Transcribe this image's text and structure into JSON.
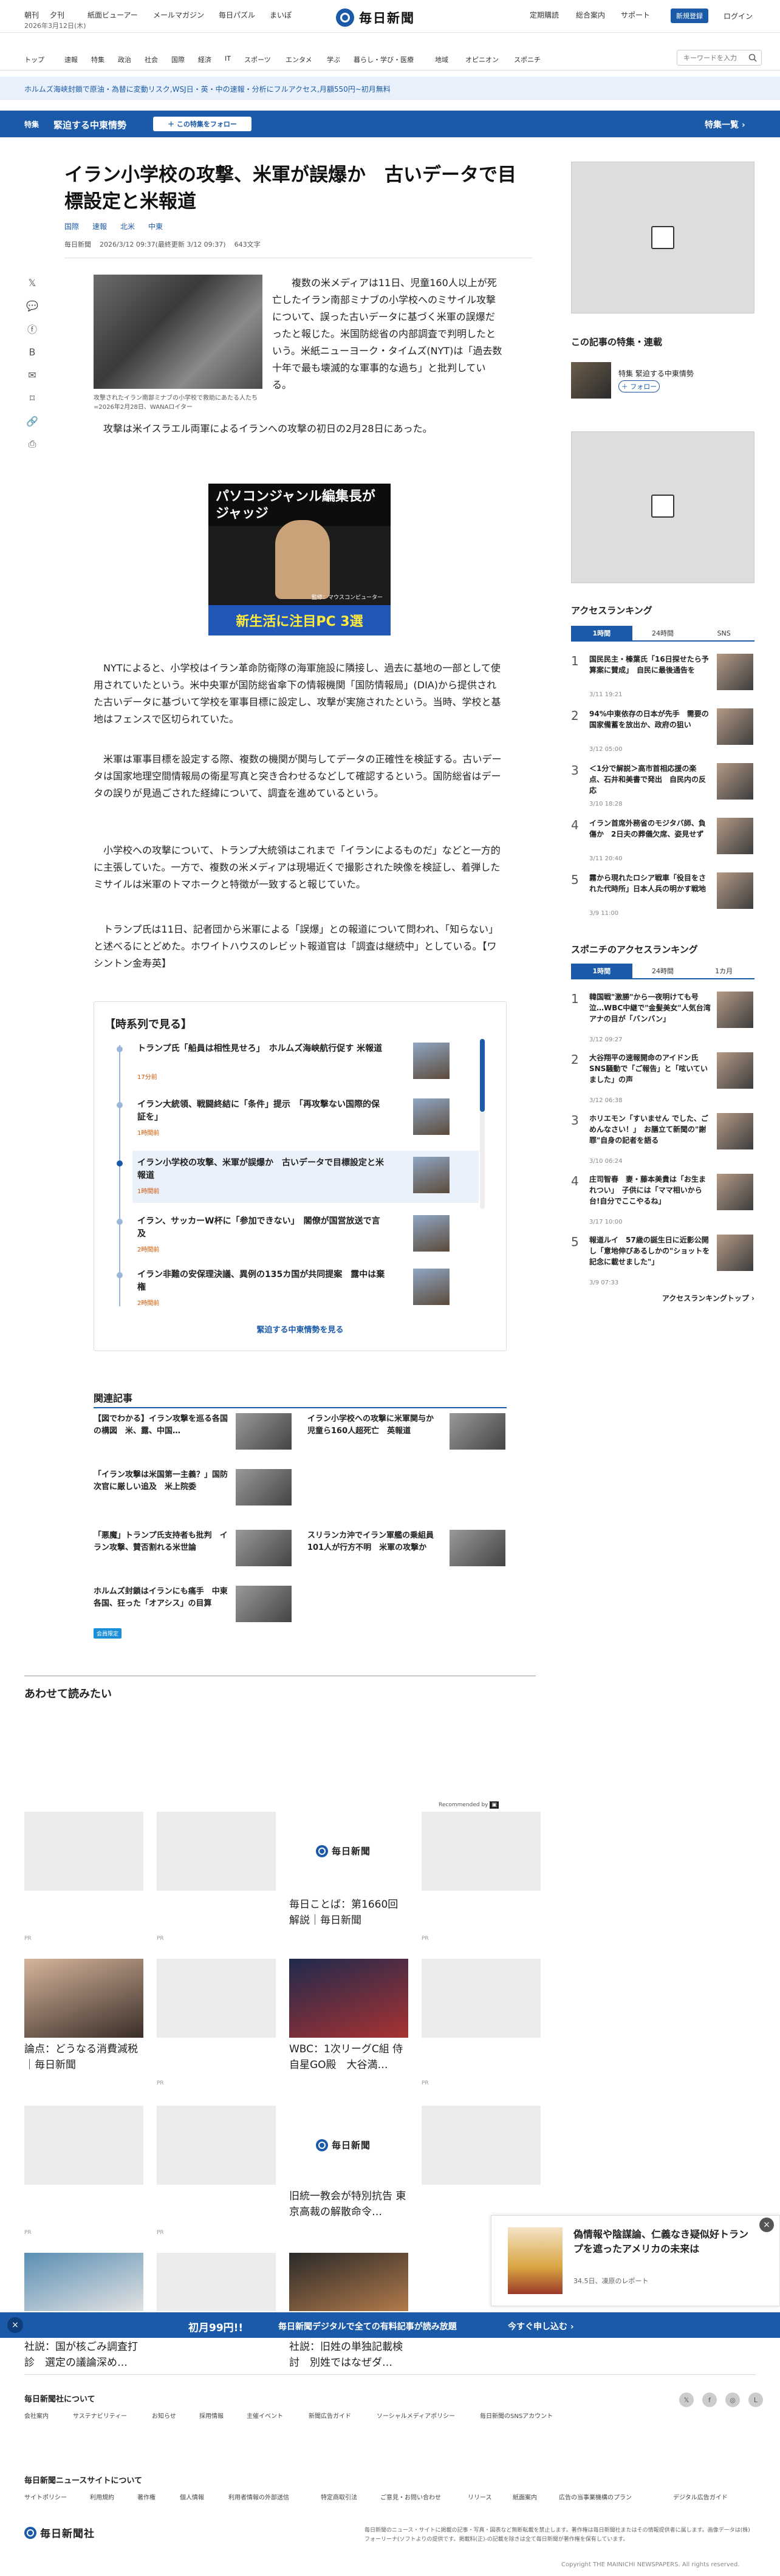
{
  "header": {
    "top_links": [
      "朝刊",
      "夕刊",
      "紙面ビューアー",
      "メールマガジン",
      "毎日パズル",
      "まいぽ"
    ],
    "date": "2026年3月12日(木)",
    "logo": "毎日新聞",
    "right_links": [
      "定期購読",
      "総合案内",
      "サポート"
    ],
    "register": "新規登録",
    "login": "ログイン"
  },
  "nav": {
    "items": [
      "トップ",
      "速報",
      "特集",
      "政治",
      "社会",
      "国際",
      "経済",
      "IT",
      "スポーツ",
      "エンタメ",
      "学ぶ",
      "暮らし・学び・医療",
      "地域",
      "オピニオン",
      "スポニチ"
    ],
    "search_placeholder": "キーワードを入力"
  },
  "promo": "ホルムズ海峡封鎖で原油・為替に変動リスク,WSJ日・英・中の速報・分析にフルアクセス,月額550円~初月無料",
  "feature": {
    "tag": "特集",
    "title": "緊迫する中東情勢",
    "follow": "＋ この特集をフォロー",
    "list": "特集一覧 ›"
  },
  "article": {
    "headline": "イラン小学校の攻撃、米軍が誤爆か　古いデータで目標設定と米報道",
    "tags": [
      "国際",
      "速報",
      "北米",
      "中東"
    ],
    "meta": [
      "毎日新聞",
      "2026/3/12 09:37(最終更新 3/12 09:37)",
      "643文字"
    ],
    "photo_caption": "攻撃されたイラン南部ミナブの小学校で救助にあたる人たち=2026年2月28日、WANAロイター",
    "p1": "複数の米メディアは11日、児童160人以上が死亡したイラン南部ミナブの小学校へのミサイル攻撃について、誤った古いデータに基づく米軍の誤爆だったと報じた。米国防総省の内部調査で判明したという。米紙ニューヨーク・タイムズ(NYT)は「過去数十年で最も壊滅的な軍事的な過ち」と批判している。",
    "p2": "攻撃は米イスラエル両軍によるイランへの攻撃の初日の2月28日にあった。",
    "p3": "NYTによると、小学校はイラン革命防衛隊の海軍施設に隣接し、過去に基地の一部として使用されていたという。米中央軍が国防総省傘下の情報機関「国防情報局」(DIA)から提供された古いデータに基づいて学校を軍事目標に設定し、攻撃が実施されたという。当時、学校と基地はフェンスで区切られていた。",
    "p4": "米軍は軍事目標を設定する際、複数の機関が関与してデータの正確性を検証する。古いデータは国家地理空間情報局の衛星写真と突き合わせるなどして確認するという。国防総省はデータの誤りが見過ごされた経緯について、調査を進めているという。",
    "p5": "小学校への攻撃について、トランプ大統領はこれまで「イランによるものだ」などと一方的に主張していた。一方で、複数の米メディアは現場近くで撮影された映像を検証し、着弾したミサイルは米軍のトマホークと特徴が一致すると報じていた。",
    "p6": "トランプ氏は11日、記者団から米軍による「誤爆」との報道について問われ、「知らない」と述べるにとどめた。ホワイトハウスのレビット報道官は「調査は継続中」としている。【ワシントン金寿英】"
  },
  "ad": {
    "top": "パソコンジャンル編集長が ジャッジ",
    "bottom": "新生活に注目PC 3選",
    "credit": "監修：マウスコンピューター"
  },
  "timeline": {
    "heading": "【時系列で見る】",
    "items": [
      {
        "title": "トランプ氏「船員は相性見せろ」　ホルムズ海峡航行促す 米報道",
        "time": "17分前"
      },
      {
        "title": "イラン大統領、戦闘終結に「条件」提示　「再攻撃ない国際的保証を」",
        "time": "1時間前"
      },
      {
        "title": "イラン小学校の攻撃、米軍が誤爆か　古いデータで目標設定と米報道",
        "time": "1時間前"
      },
      {
        "title": "イラン、サッカーW杯に「参加できない」　閣僚が国営放送で言及",
        "time": "2時間前"
      },
      {
        "title": "イラン非難の安保理決議、異例の135カ国が共同提案　露中は棄権",
        "time": "2時間前"
      }
    ],
    "more": "緊迫する中東情勢を見る"
  },
  "related": {
    "heading": "関連記事",
    "items": [
      {
        "title": "【図でわかる】イラン攻撃を巡る各国の構図　米、露、中国…"
      },
      {
        "title": "イラン小学校への攻撃に米軍関与か　児童ら160人超死亡　英報道"
      },
      {
        "title": "「イラン攻撃は米国第一主義？」国防次官に厳しい追及　米上院委"
      },
      {
        "title": "「悪魔」トランプ氏支持者も批判　イラン攻撃、賛否割れる米世論"
      },
      {
        "title": "スリランカ沖でイラン軍艦の乗組員101人が行方不明　米軍の攻撃か"
      },
      {
        "title": "ホルムズ封鎖はイランにも痛手　中東各国、狂った「オアシス」の目算"
      }
    ],
    "gift": "会員限定"
  },
  "read_together": {
    "heading": "あわせて読みたい",
    "recommended": "Recommended by",
    "pr": "PR",
    "captions": [
      "毎日ことば：第1660回 解説｜毎日新聞",
      "論点：どうなる消費減税｜毎日新聞",
      "WBC：1次リーグC組 侍自星GO殿　大谷満…",
      "旧統一教会が特別抗告 東京高裁の解散命令…",
      "社説：国が核ごみ調査打診　選定の議論深め…",
      "社説：旧姓の単独記載検討　別姓ではなぜダ…"
    ]
  },
  "sidebar": {
    "follow_heading": "この記事の特集・連載",
    "follow_tag": "特集 緊迫する中東情勢",
    "follow_btn": "＋ フォロー",
    "ranking_heading": "アクセスランキング",
    "ranking_tabs": [
      "1時間",
      "24時間",
      "SNS"
    ],
    "ranking": [
      {
        "n": "1",
        "title": "国民民主・榛葉氏「16日探せたら予算案に賛成」　自民に最後通告を"
      },
      {
        "n": "2",
        "title": "94%中東依存の日本が先手　需要の国家備蓄を放出か、政府の狙い"
      },
      {
        "n": "3",
        "title": "＜1分で解説＞高市首相応援の楽点、石井和美書で発出　自民内の反応"
      },
      {
        "n": "4",
        "title": "イラン首席外務省のモジタバ師、負傷か　2日夫の葬儀欠席、姿見せず"
      },
      {
        "n": "5",
        "title": "霧から現れたロシア戦車「役目をされた代時所」日本人兵の明かす戦地"
      }
    ],
    "ranking_dates": [
      "3/11 19:21",
      "3/12 05:00",
      "3/10 18:28",
      "3/11 20:40",
      "3/9 11:00"
    ],
    "sponichi_heading": "スポニチのアクセスランキング",
    "sponichi_tabs": [
      "1時間",
      "24時間",
      "1カ月"
    ],
    "sponichi": [
      {
        "n": "1",
        "title": "韓国戦\"激勝\"から一夜明けても号泣…WBC中継で\"金髪美女\"人気台湾アナの目が「バンバン」"
      },
      {
        "n": "2",
        "title": "大谷翔平の速報開命のアイドン氏　SNS騒動で「ご報告」と「呟いていました」の声"
      },
      {
        "n": "3",
        "title": "ホリエモン「すいません でした、ごめんなさい！」　お膳立て新聞の\"謝罪\"自身の記者を語る"
      },
      {
        "n": "4",
        "title": "庄司智春　妻・藤本美貴は「お生まれつい」　子供には「ママ相いから台!自分でここやるね」"
      },
      {
        "n": "5",
        "title": "報道ルイ　57歳の誕生日に近影公開し「意地伸びあるしかの\"ショットを記念に載せました\"」"
      }
    ],
    "sponichi_dates": [
      "3/12 09:27",
      "3/12 06:38",
      "3/10 06:24",
      "3/17 10:00",
      "3/9 07:33"
    ],
    "ranking_more": "アクセスランキングトップ ›"
  },
  "sticky": {
    "title": "偽情報や陰謀論、仁義なき疑似好トランプを遮ったアメリカの未来は",
    "sub": "34.5日、凍原のレポート",
    "close": "×"
  },
  "subscribe": {
    "close": "×",
    "price": "初月99円!!",
    "text": "毎日新聞デジタルで全ての有料記事が読み放題",
    "cta": "今すぐ申し込む ›"
  },
  "footer": {
    "h1": "毎日新聞社について",
    "links1": [
      "会社案内",
      "サステナビリティー",
      "お知らせ",
      "採用情報",
      "主催イベント",
      "新聞広告ガイド",
      "ソーシャルメディアポリシー",
      "毎日新聞のSNSアカウント"
    ],
    "h2": "毎日新聞ニュースサイトについて",
    "links2": [
      "サイトポリシー",
      "利用規約",
      "著作権",
      "個人情報",
      "利用者情報の外部送信",
      "特定商取引法",
      "ご意見・お問い合わせ",
      "リリース",
      "紙面案内",
      "広告の当事業機構のプラン",
      "デジタル広告ガイド"
    ],
    "note": "毎日新聞のニュース・サイトに掲載の記事・写真・図表など無断転載を禁止します。著作権は毎日新聞社またはその情報提供者に属します。画像データは(株)フォーリーナ(ソフトよりの提供です。掲載料(正)-の記載を除きは全て毎日新聞が著作権を保有しています。",
    "copyright": "Copyright THE MAINICHI NEWSPAPERS. All rights reserved.",
    "logo": "毎日新聞社"
  }
}
